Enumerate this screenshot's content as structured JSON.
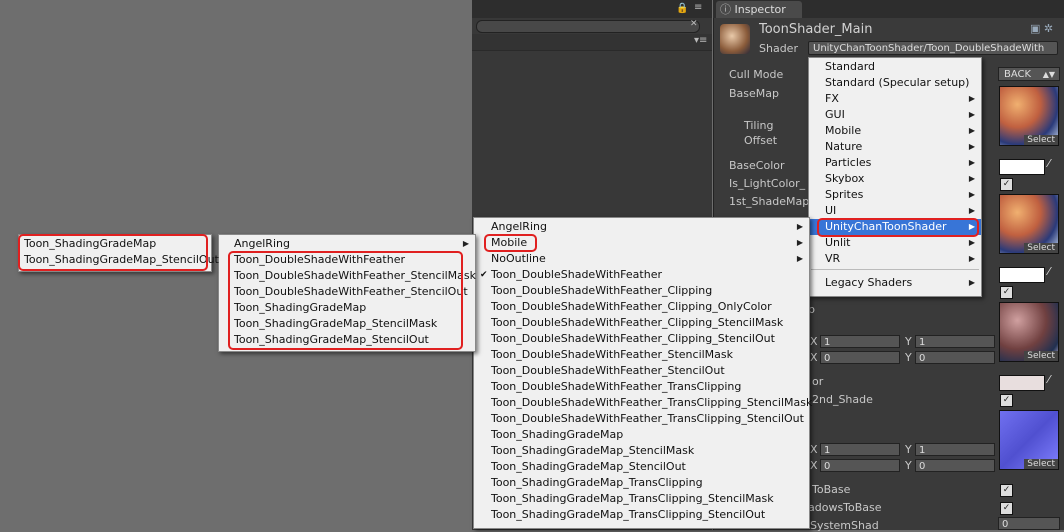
{
  "inspector": {
    "tab_label": "Inspector",
    "material_name": "ToonShader_Main",
    "shader_label": "Shader",
    "shader_value": "UnityChanToonShader/Toon_DoubleShadeWith",
    "properties": {
      "cull_mode": "Cull Mode",
      "cull_value": "BACK",
      "base_map": "BaseMap",
      "tiling": "Tiling",
      "offset": "Offset",
      "base_color": "BaseColor",
      "is_light_color": "Is_LightColor_",
      "first_shade_map": "1st_ShadeMap",
      "partial_p": "p",
      "partial_or": "or",
      "second_shade": "2nd_Shade",
      "x1_label": "X",
      "x1_value": "1",
      "y1_label": "Y",
      "y1_value": "1",
      "x2_label": "X",
      "x2_value": "0",
      "y2_label": "Y",
      "y2_value": "0",
      "x3_label": "X",
      "x3_value": "1",
      "y3_label": "Y",
      "y3_value": "1",
      "x4_label": "X",
      "x4_value": "0",
      "y4_label": "Y",
      "y4_value": "0",
      "to_base": "ToBase",
      "shadows_to_base": "adowsToBase",
      "stencil_shad": "SystemShad",
      "bottom_value": "0",
      "select_label": "Select"
    }
  },
  "menus": {
    "shader_menu": [
      {
        "label": "Standard",
        "arrow": false
      },
      {
        "label": "Standard (Specular setup)",
        "arrow": false
      },
      {
        "label": "FX",
        "arrow": true
      },
      {
        "label": "GUI",
        "arrow": true
      },
      {
        "label": "Mobile",
        "arrow": true
      },
      {
        "label": "Nature",
        "arrow": true
      },
      {
        "label": "Particles",
        "arrow": true
      },
      {
        "label": "Skybox",
        "arrow": true
      },
      {
        "label": "Sprites",
        "arrow": true
      },
      {
        "label": "UI",
        "arrow": true
      },
      {
        "label": "UnityChanToonShader",
        "arrow": true
      },
      {
        "label": "Unlit",
        "arrow": true
      },
      {
        "label": "VR",
        "arrow": true
      },
      {
        "label": "Legacy Shaders",
        "arrow": true
      }
    ],
    "toon_menu": [
      {
        "label": "AngelRing",
        "arrow": true
      },
      {
        "label": "Mobile",
        "arrow": true
      },
      {
        "label": "NoOutline",
        "arrow": true
      },
      {
        "label": "Toon_DoubleShadeWithFeather",
        "checked": true
      },
      {
        "label": "Toon_DoubleShadeWithFeather_Clipping"
      },
      {
        "label": "Toon_DoubleShadeWithFeather_Clipping_OnlyColor"
      },
      {
        "label": "Toon_DoubleShadeWithFeather_Clipping_StencilMask"
      },
      {
        "label": "Toon_DoubleShadeWithFeather_Clipping_StencilOut"
      },
      {
        "label": "Toon_DoubleShadeWithFeather_StencilMask"
      },
      {
        "label": "Toon_DoubleShadeWithFeather_StencilOut"
      },
      {
        "label": "Toon_DoubleShadeWithFeather_TransClipping"
      },
      {
        "label": "Toon_DoubleShadeWithFeather_TransClipping_StencilMask"
      },
      {
        "label": "Toon_DoubleShadeWithFeather_TransClipping_StencilOut"
      },
      {
        "label": "Toon_ShadingGradeMap"
      },
      {
        "label": "Toon_ShadingGradeMap_StencilMask"
      },
      {
        "label": "Toon_ShadingGradeMap_StencilOut"
      },
      {
        "label": "Toon_ShadingGradeMap_TransClipping"
      },
      {
        "label": "Toon_ShadingGradeMap_TransClipping_StencilMask"
      },
      {
        "label": "Toon_ShadingGradeMap_TransClipping_StencilOut"
      }
    ],
    "mobile_menu": [
      {
        "label": "AngelRing",
        "arrow": true
      },
      {
        "label": "Toon_DoubleShadeWithFeather"
      },
      {
        "label": "Toon_DoubleShadeWithFeather_StencilMask"
      },
      {
        "label": "Toon_DoubleShadeWithFeather_StencilOut"
      },
      {
        "label": "Toon_ShadingGradeMap"
      },
      {
        "label": "Toon_ShadingGradeMap_StencilMask"
      },
      {
        "label": "Toon_ShadingGradeMap_StencilOut"
      }
    ],
    "angelring_menu": [
      {
        "label": "Toon_ShadingGradeMap"
      },
      {
        "label": "Toon_ShadingGradeMap_StencilOut"
      }
    ]
  },
  "colors": {
    "highlight": "#3875d7",
    "annotation_red": "#e02020"
  }
}
